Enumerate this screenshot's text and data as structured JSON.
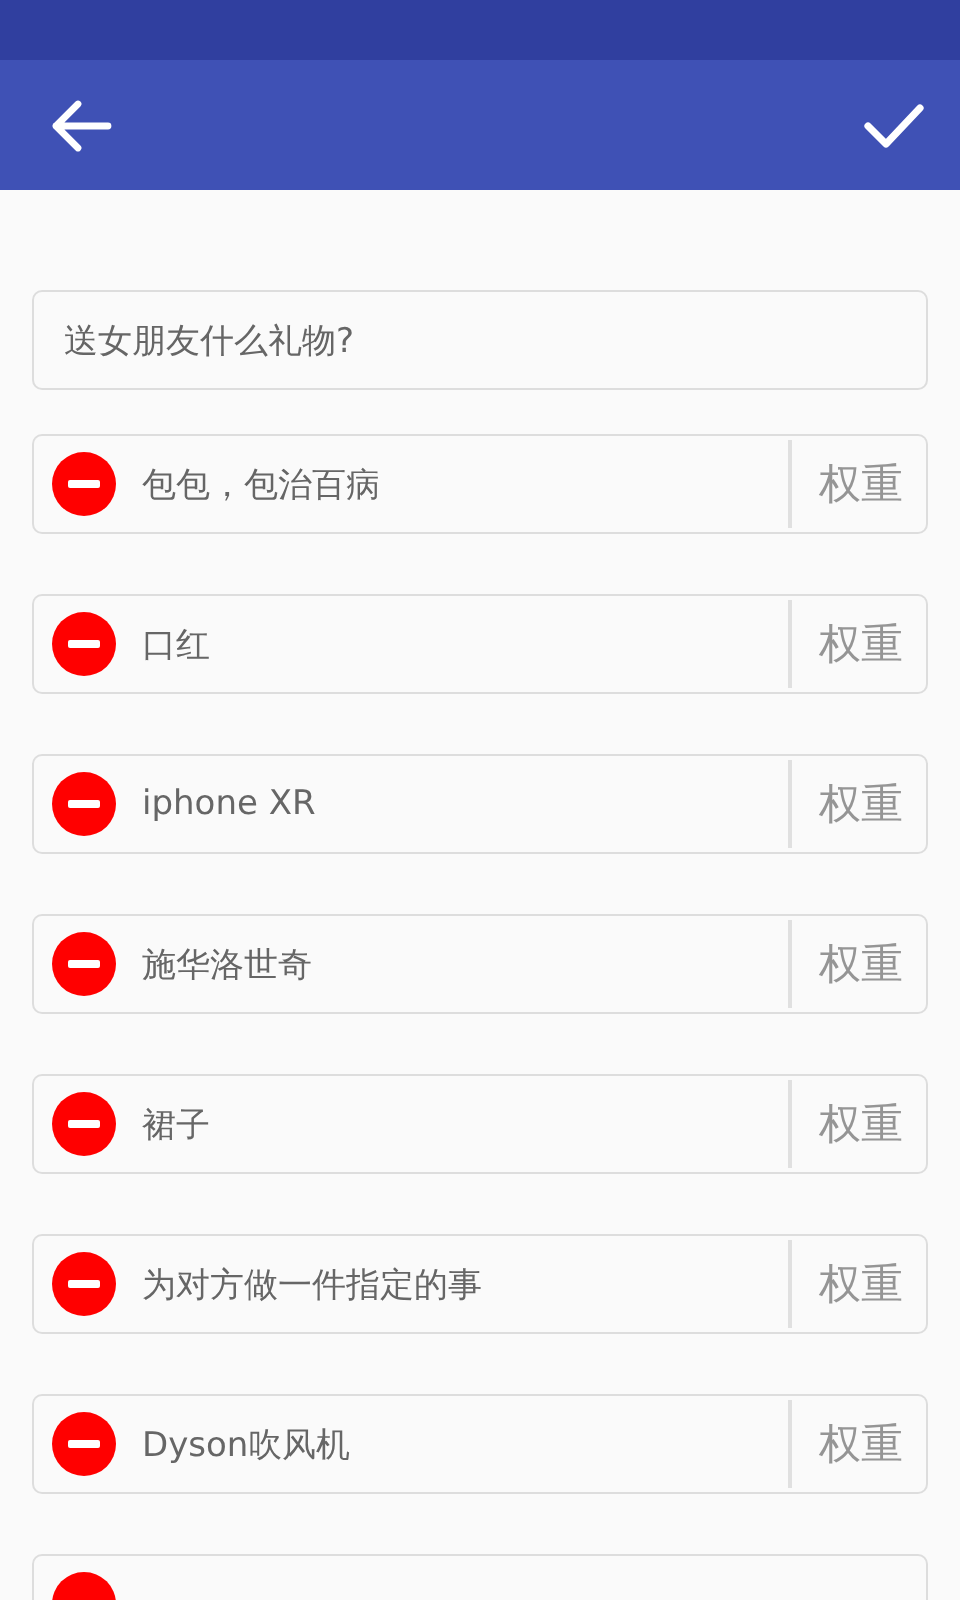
{
  "question": {
    "value": "送女朋友什么礼物?"
  },
  "options": [
    {
      "text": "包包，包治百病",
      "weight_placeholder": "权重"
    },
    {
      "text": "口红",
      "weight_placeholder": "权重"
    },
    {
      "text": "iphone XR",
      "weight_placeholder": "权重"
    },
    {
      "text": "施华洛世奇",
      "weight_placeholder": "权重"
    },
    {
      "text": "裙子",
      "weight_placeholder": "权重"
    },
    {
      "text": "为对方做一件指定的事",
      "weight_placeholder": "权重"
    },
    {
      "text": "Dyson吹风机",
      "weight_placeholder": "权重"
    },
    {
      "kind": "partial"
    }
  ]
}
